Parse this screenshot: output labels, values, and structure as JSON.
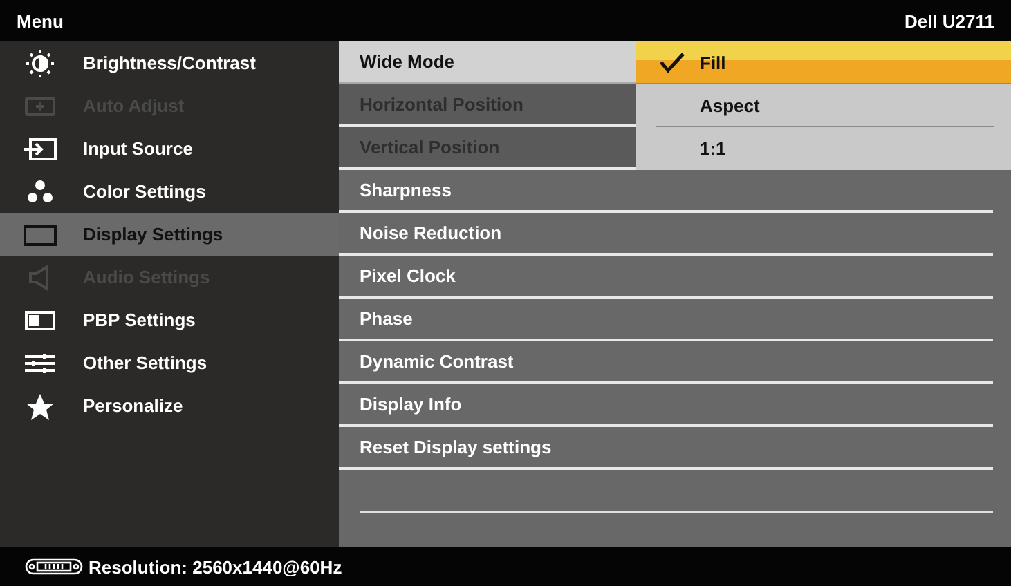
{
  "header": {
    "title": "Menu",
    "model": "Dell U2711"
  },
  "menu": [
    {
      "label": "Brightness/Contrast",
      "selected": false,
      "disabled": false
    },
    {
      "label": "Auto Adjust",
      "selected": false,
      "disabled": true
    },
    {
      "label": "Input Source",
      "selected": false,
      "disabled": false
    },
    {
      "label": "Color Settings",
      "selected": false,
      "disabled": false
    },
    {
      "label": "Display Settings",
      "selected": true,
      "disabled": false
    },
    {
      "label": "Audio Settings",
      "selected": false,
      "disabled": true
    },
    {
      "label": "PBP Settings",
      "selected": false,
      "disabled": false
    },
    {
      "label": "Other Settings",
      "selected": false,
      "disabled": false
    },
    {
      "label": "Personalize",
      "selected": false,
      "disabled": false
    }
  ],
  "submenu": [
    {
      "label": "Wide Mode",
      "selected": true,
      "disabled": false
    },
    {
      "label": "Horizontal Position",
      "selected": false,
      "disabled": true
    },
    {
      "label": "Vertical Position",
      "selected": false,
      "disabled": true
    },
    {
      "label": "Sharpness",
      "selected": false,
      "disabled": false
    },
    {
      "label": "Noise Reduction",
      "selected": false,
      "disabled": false
    },
    {
      "label": "Pixel Clock",
      "selected": false,
      "disabled": false
    },
    {
      "label": "Phase",
      "selected": false,
      "disabled": false
    },
    {
      "label": "Dynamic Contrast",
      "selected": false,
      "disabled": false
    },
    {
      "label": "Display Info",
      "selected": false,
      "disabled": false
    },
    {
      "label": "Reset Display settings",
      "selected": false,
      "disabled": false
    }
  ],
  "options": [
    {
      "label": "Fill",
      "selected": true
    },
    {
      "label": "Aspect",
      "selected": false
    },
    {
      "label": "1:1",
      "selected": false
    }
  ],
  "status_bar": {
    "text": "Resolution: 2560x1440@60Hz"
  }
}
